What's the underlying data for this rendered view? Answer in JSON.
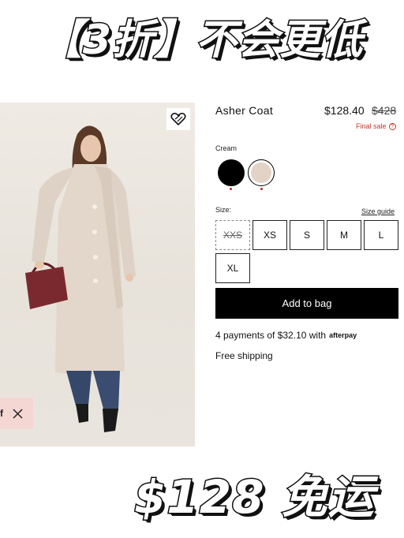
{
  "banners": {
    "top": "【3折】不会更低",
    "bottom": "$128 免运"
  },
  "product": {
    "name": "Asher Coat",
    "price": "$128.40",
    "original_price": "$428",
    "final_sale": "Final sale",
    "final_sale_icon": "question-icon"
  },
  "color": {
    "label": "Cream",
    "swatches": [
      {
        "name": "black",
        "hex": "#000000"
      },
      {
        "name": "cream",
        "hex": "#e3d3c7",
        "selected": true
      }
    ],
    "dot_color": "#b3262b"
  },
  "size": {
    "label": "Size:",
    "guide": "Size guide",
    "options": [
      {
        "label": "XXS",
        "available": false
      },
      {
        "label": "XS",
        "available": true
      },
      {
        "label": "S",
        "available": true
      },
      {
        "label": "M",
        "available": true
      },
      {
        "label": "L",
        "available": true
      },
      {
        "label": "XL",
        "available": true
      }
    ]
  },
  "cta": {
    "add_to_bag": "Add to bag"
  },
  "payments": {
    "text": "4 payments of $32.10 with",
    "provider": "afterpay"
  },
  "shipping": "Free shipping",
  "promo": {
    "letter": "f",
    "close_icon": "close-icon",
    "background": "#f4d7d2"
  },
  "wishlist_icon": "heart-icon"
}
